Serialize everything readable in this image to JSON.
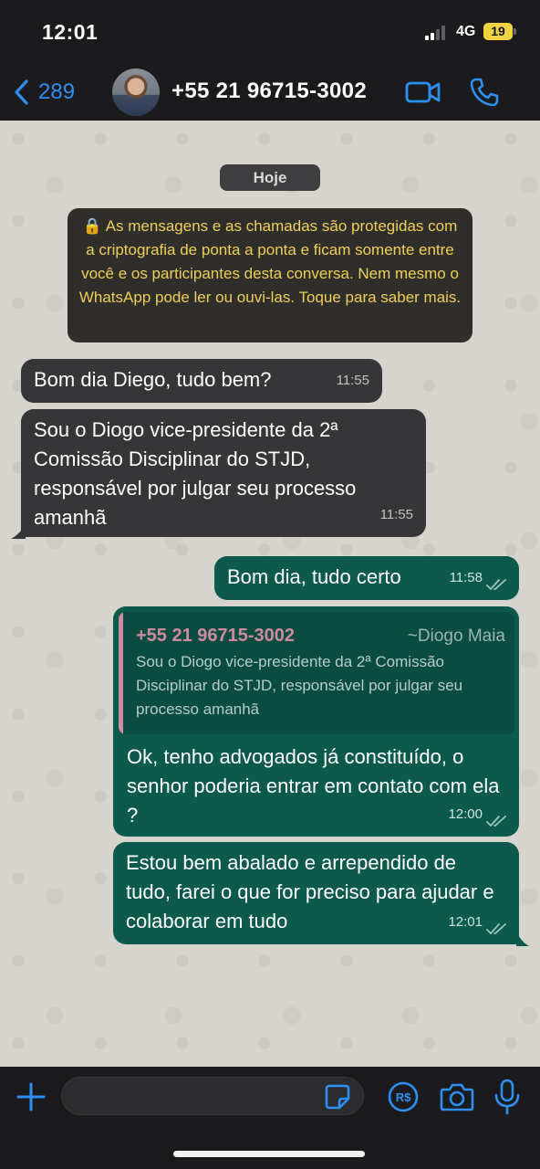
{
  "status_bar": {
    "time": "12:01",
    "network": "4G",
    "battery": "19"
  },
  "header": {
    "back_count": "289",
    "contact": "+55 21 96715-3002"
  },
  "chat": {
    "date_label": "Hoje",
    "encryption_notice": "🔒 As mensagens e as chamadas são protegidas com a criptografia de ponta a ponta e ficam somente entre você e os participantes desta conversa. Nem mesmo o WhatsApp pode ler ou ouvi-las. Toque para saber mais.",
    "messages": [
      {
        "text": "Bom dia Diego, tudo bem?",
        "time": "11:55"
      },
      {
        "text": "Sou o Diogo vice-presidente da 2ª Comissão Disciplinar do STJD, responsável por julgar seu processo amanhã",
        "time": "11:55"
      },
      {
        "text": "Bom dia, tudo certo",
        "time": "11:58"
      },
      {
        "quote": {
          "number": "+55 21 96715-3002",
          "author": "~Diogo Maia",
          "text": "Sou o Diogo vice-presidente da 2ª Comissão Disciplinar do STJD, responsável por julgar seu processo amanhã"
        },
        "text": "Ok, tenho advogados já constituído, o senhor poderia entrar em contato com ela ?",
        "time": "12:00"
      },
      {
        "text": "Estou bem abalado e arrependido de tudo, farei o que for preciso para ajudar e colaborar em tudo",
        "time": "12:01"
      }
    ]
  },
  "input_bar": {
    "placeholder": ""
  },
  "icons": {
    "back": "chevron-left-icon",
    "video": "video-camera-icon",
    "call": "phone-icon",
    "plus": "plus-icon",
    "sticker": "sticker-icon",
    "payment": "payment-icon",
    "camera": "camera-icon",
    "mic": "microphone-icon",
    "lock": "lock-icon"
  },
  "colors": {
    "accent": "#2e8ff2",
    "outgoing": "#0b5a4b",
    "incoming": "#363638",
    "notice_text": "#f0cf58",
    "wallpaper": "#d7d3cd"
  }
}
